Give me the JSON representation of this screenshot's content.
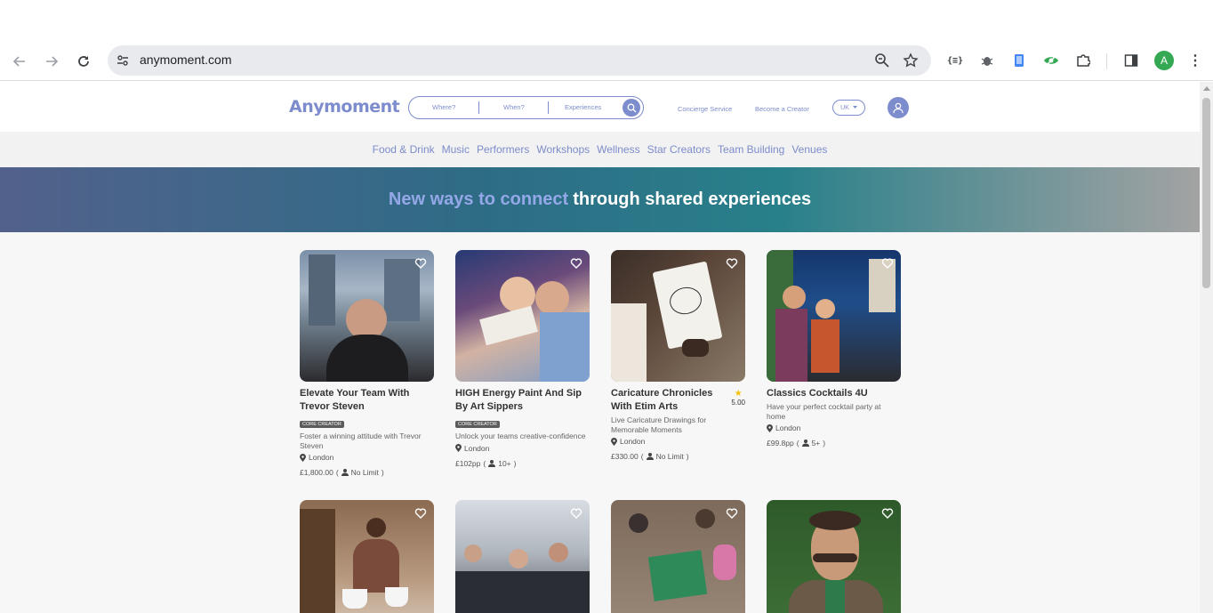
{
  "browser": {
    "url": "anymoment.com",
    "profile_initial": "A",
    "extensions": [
      "json-viewer-icon",
      "bug-icon",
      "phone-icon",
      "eye-extension-icon",
      "puzzle-icon"
    ]
  },
  "site": {
    "logo": "Anymoment",
    "search": {
      "where": "Where?",
      "when": "When?",
      "what": "Experiences"
    },
    "links": {
      "concierge": "Concierge Service",
      "creator": "Become a Creator"
    },
    "region": "UK",
    "categories": [
      "Food & Drink",
      "Music",
      "Performers",
      "Workshops",
      "Wellness",
      "Star Creators",
      "Team Building",
      "Venues"
    ],
    "banner": {
      "highlight": "New ways to connect",
      "rest": "through shared experiences"
    },
    "cards": [
      {
        "title": "Elevate Your Team With Trevor Steven",
        "badge": "CORE CREATOR",
        "desc": "Foster a winning attitude with Trevor Steven",
        "location": "London",
        "price": "£1,800.00",
        "capacity": "No Limit"
      },
      {
        "title": "HIGH Energy Paint And Sip By Art Sippers",
        "badge": "CORE CREATOR",
        "desc": "Unlock your teams creative-confidence",
        "location": "London",
        "price": "£102pp",
        "capacity": "10+"
      },
      {
        "title": "Caricature Chronicles With Etim Arts",
        "rating": "5.00",
        "desc": "Live Caricature Drawings for Memorable Moments",
        "location": "London",
        "price": "£330.00",
        "capacity": "No Limit"
      },
      {
        "title": "Classics Cocktails 4U",
        "desc": "Have your perfect cocktail party at home",
        "location": "London",
        "price": "£99.8pp",
        "capacity": "5+"
      }
    ],
    "accent": "#7d8ccc"
  }
}
